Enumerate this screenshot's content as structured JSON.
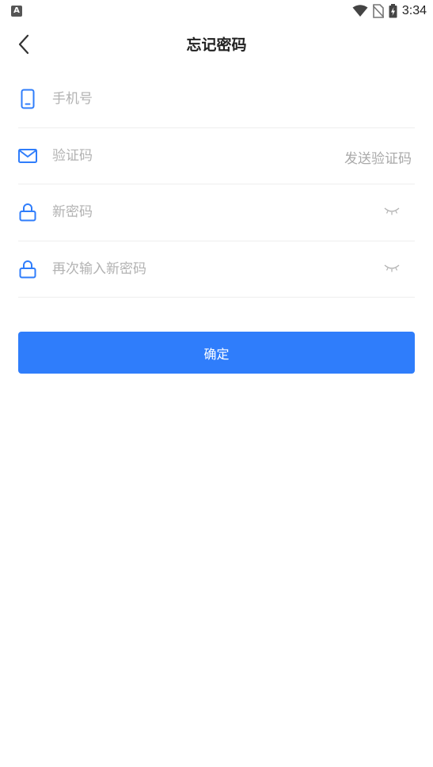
{
  "status_bar": {
    "time": "3:34",
    "left_icon_glyph": "A"
  },
  "header": {
    "title": "忘记密码"
  },
  "form": {
    "phone_placeholder": "手机号",
    "code_placeholder": "验证码",
    "send_code_label": "发送验证码",
    "new_password_placeholder": "新密码",
    "confirm_password_placeholder": "再次输入新密码"
  },
  "confirm_button_label": "确定",
  "icons": {
    "phone": "phone-icon",
    "mail": "mail-icon",
    "lock": "lock-icon",
    "eye_closed": "eye-closed-icon",
    "back": "chevron-left-icon"
  },
  "colors": {
    "accent": "#2f7dfb",
    "icon_blue": "#2f7dfb",
    "placeholder": "#b2b2b2"
  }
}
